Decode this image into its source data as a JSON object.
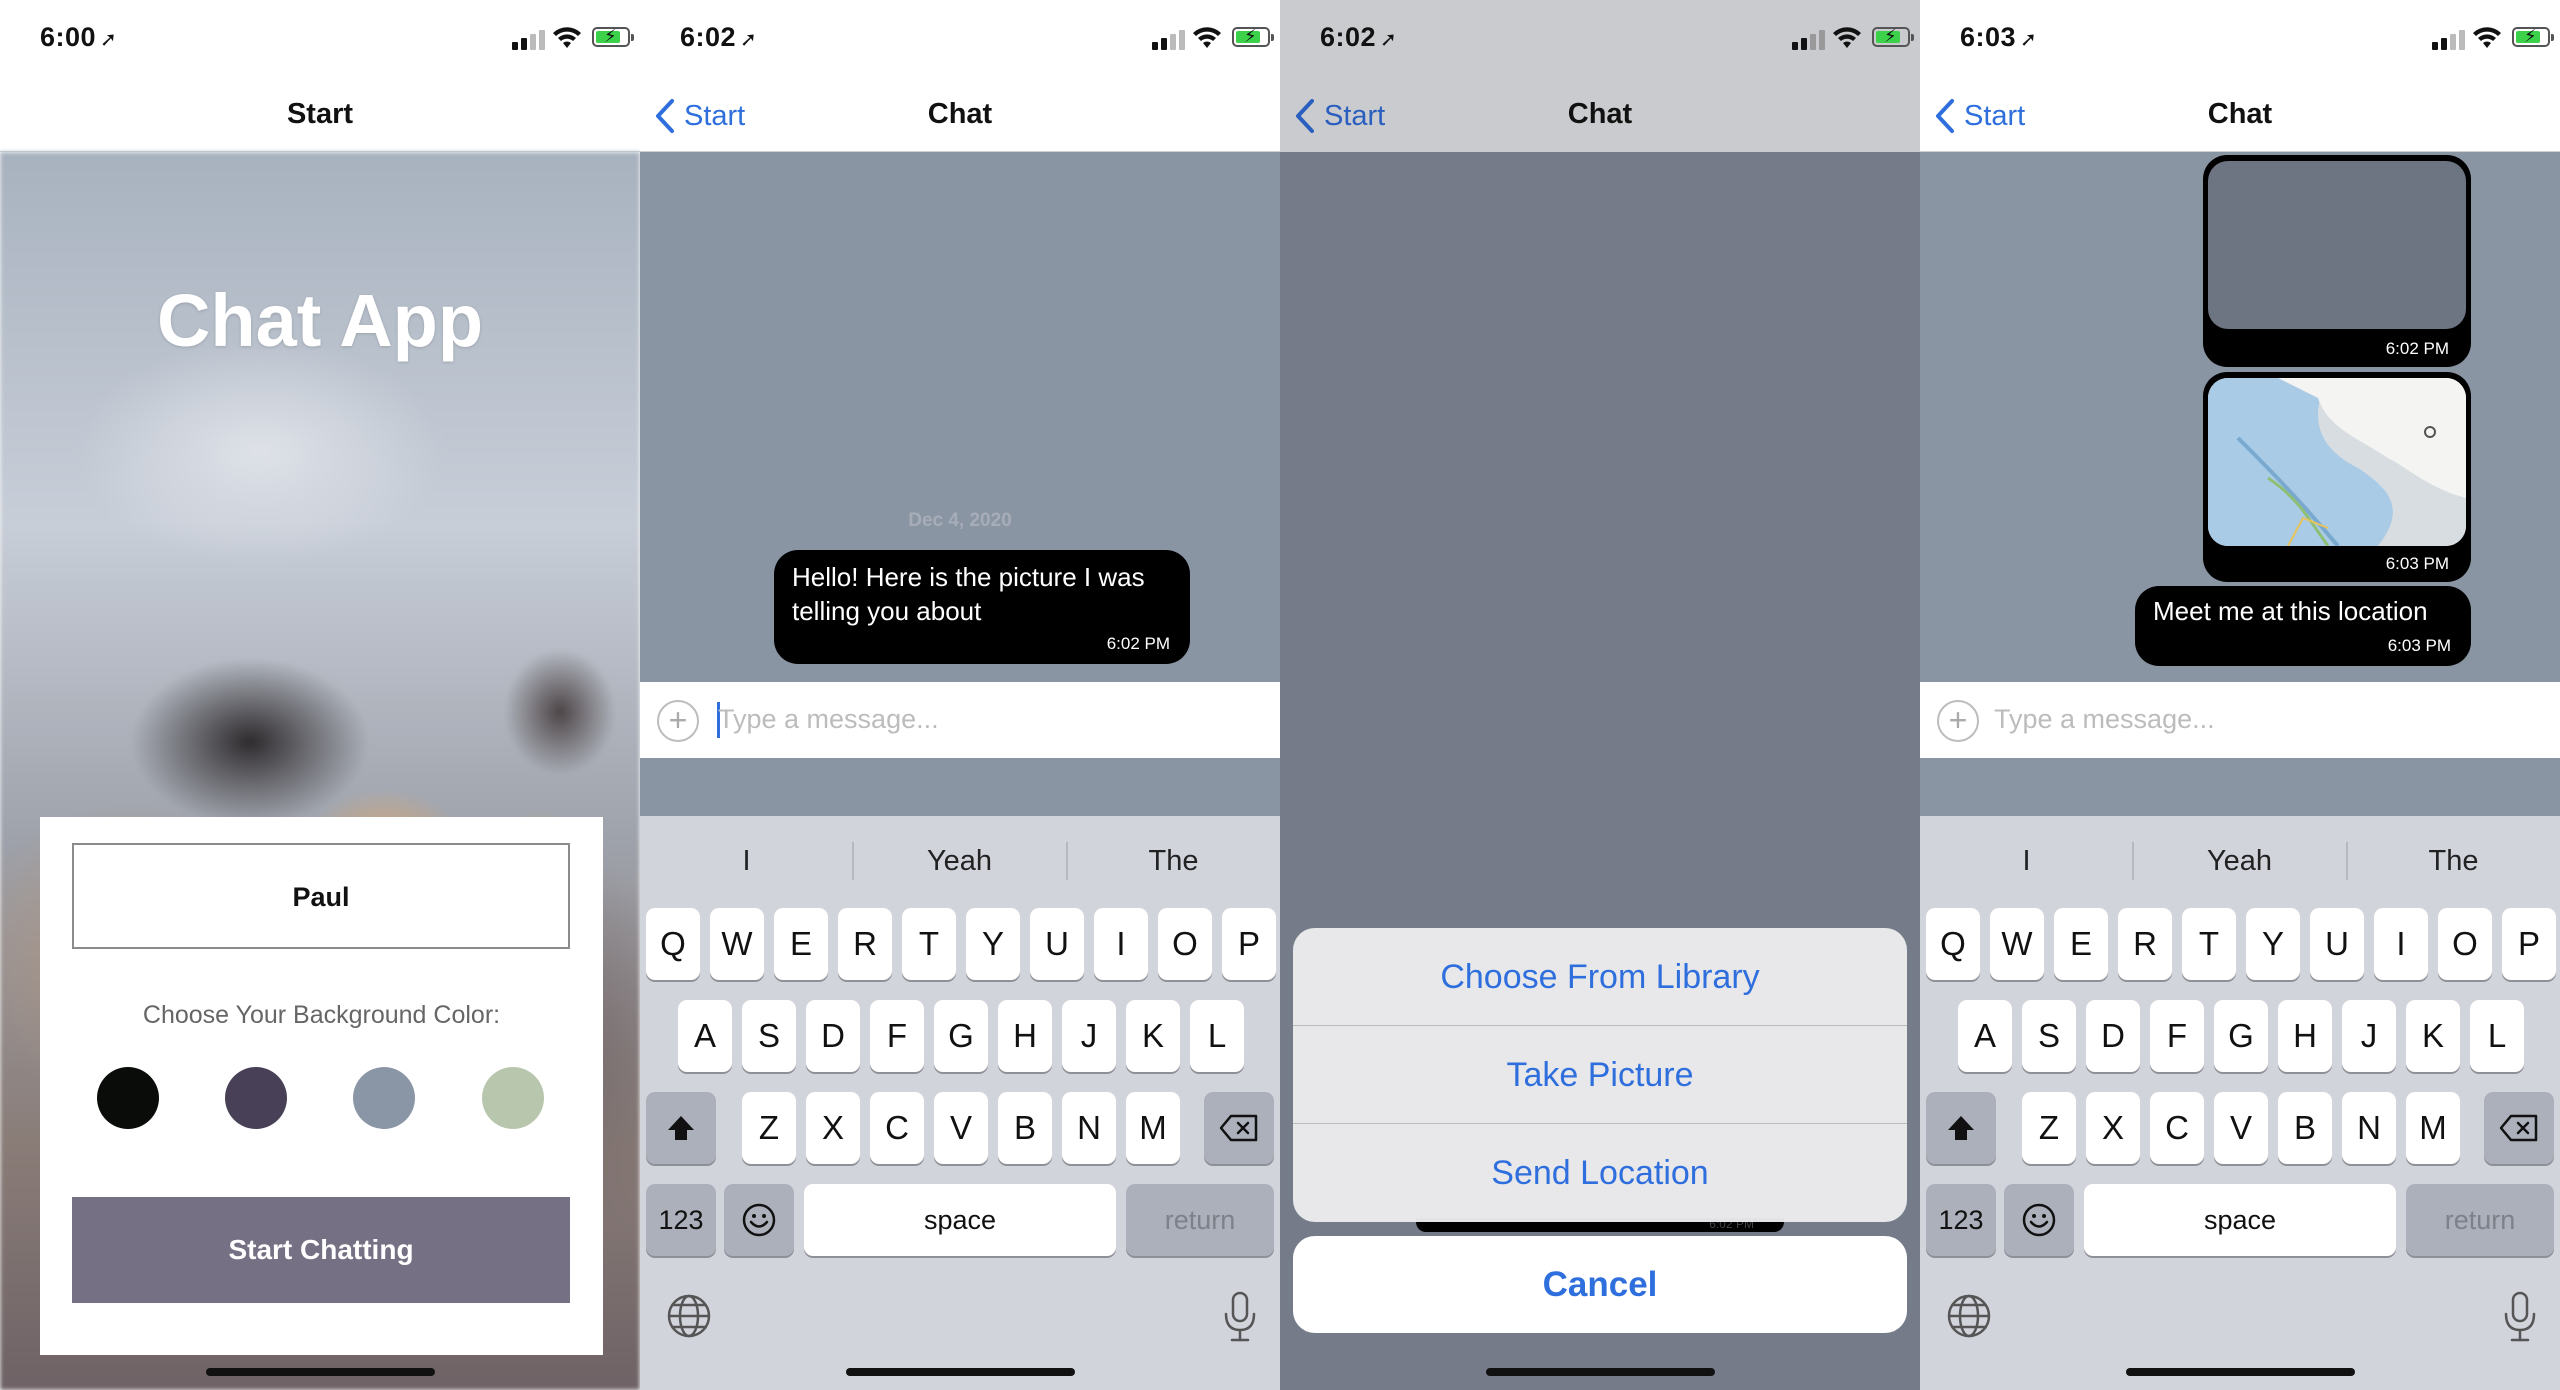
{
  "panels": {
    "start": {
      "time": "6:00",
      "nav_title": "Start",
      "app_title": "Chat App",
      "name_value": "Paul",
      "choose_label": "Choose Your Background Color:",
      "colors": [
        "#090C08",
        "#474056",
        "#8A95A5",
        "#B9C6AE"
      ],
      "start_button": "Start Chatting"
    },
    "chat": {
      "time": "6:02",
      "back_label": "Start",
      "nav_title": "Chat",
      "date": "Dec 4, 2020",
      "message": "Hello! Here is the picture I was telling you about",
      "message_time": "6:02 PM",
      "placeholder": "Type a message..."
    },
    "sheet": {
      "time": "6:02",
      "back_label": "Start",
      "nav_title": "Chat",
      "options": [
        "Choose From Library",
        "Take Picture",
        "Send Location"
      ],
      "cancel": "Cancel",
      "peek_time": "6:02 PM"
    },
    "location": {
      "time": "6:03",
      "back_label": "Start",
      "nav_title": "Chat",
      "image_time": "6:02 PM",
      "map_time": "6:03 PM",
      "message": "Meet me at this location",
      "message_time": "6:03 PM",
      "placeholder": "Type a message..."
    }
  },
  "keyboard": {
    "suggestions": [
      "I",
      "Yeah",
      "The"
    ],
    "row1": [
      "Q",
      "W",
      "E",
      "R",
      "T",
      "Y",
      "U",
      "I",
      "O",
      "P"
    ],
    "row2": [
      "A",
      "S",
      "D",
      "F",
      "G",
      "H",
      "J",
      "K",
      "L"
    ],
    "row3": [
      "Z",
      "X",
      "C",
      "V",
      "B",
      "N",
      "M"
    ],
    "numbers": "123",
    "space": "space",
    "return": "return",
    "icons": [
      "shift-icon",
      "backspace-icon",
      "emoji-icon",
      "globe-icon",
      "microphone-icon"
    ]
  },
  "accent_color": "#2F6FDD"
}
